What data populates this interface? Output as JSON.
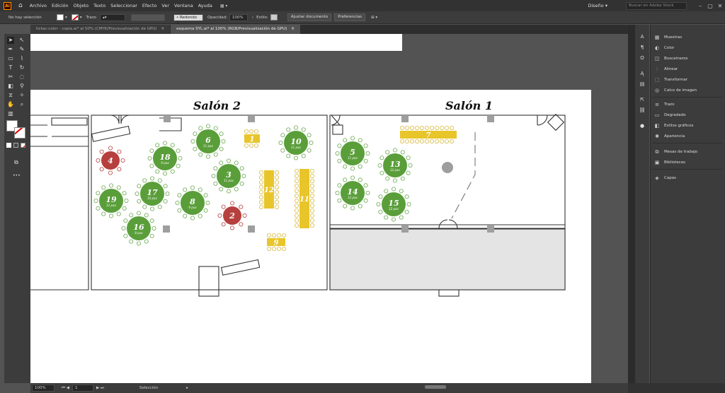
{
  "app": {
    "logo": "Ai"
  },
  "menu": [
    "Archivo",
    "Edición",
    "Objeto",
    "Texto",
    "Seleccionar",
    "Efecto",
    "Ver",
    "Ventana",
    "Ayuda"
  ],
  "workspace": "Diseño",
  "search_placeholder": "Buscar en Adobe Stock",
  "control": {
    "selection": "No hay selección",
    "stroke_label": "Trazo",
    "brush": "Redondo 3",
    "opacity_label": "Opacidad:",
    "opacity_value": "100%",
    "style_label": "Estilo:",
    "doc_button": "Ajustar documento",
    "prefs_button": "Preferencias"
  },
  "tabs": [
    {
      "label": "tictac-color - copia.ai* al 50% (CMYK/Previsualización de GPU)",
      "active": false
    },
    {
      "label": "esquema SYL.ai* al 100% (RGB/Previsualización de GPU)",
      "active": true
    }
  ],
  "panels": [
    "Muestras",
    "Color",
    "Buscatrazos",
    "Alinear",
    "Transformar",
    "Calco de imagen",
    "Trazo",
    "Degradado",
    "Estilos gráficos",
    "Apariencia",
    "Mesas de trabajo",
    "Bibliotecas",
    "Capas"
  ],
  "status": {
    "zoom": "100%",
    "page": "1",
    "tool": "Selección"
  },
  "plan": {
    "salon2_title": "Salón 2",
    "salon1_title": "Salón 1",
    "pax_suffix": "pax",
    "round_tables": [
      {
        "num": "18",
        "pax": "9",
        "color": "green"
      },
      {
        "num": "6",
        "pax": "11",
        "color": "green"
      },
      {
        "num": "10",
        "pax": "11",
        "color": "green"
      },
      {
        "num": "4",
        "pax": "",
        "color": "red"
      },
      {
        "num": "3",
        "pax": "11",
        "color": "green"
      },
      {
        "num": "17",
        "pax": "10",
        "color": "green"
      },
      {
        "num": "19",
        "pax": "12",
        "color": "green"
      },
      {
        "num": "8",
        "pax": "9",
        "color": "green"
      },
      {
        "num": "2",
        "pax": "",
        "color": "red"
      },
      {
        "num": "16",
        "pax": "8",
        "color": "green"
      },
      {
        "num": "5",
        "pax": "11",
        "color": "green"
      },
      {
        "num": "13",
        "pax": "12",
        "color": "green"
      },
      {
        "num": "14",
        "pax": "12",
        "color": "green"
      },
      {
        "num": "15",
        "pax": "12",
        "color": "green"
      }
    ],
    "rect_tables": [
      {
        "num": "1"
      },
      {
        "num": "12"
      },
      {
        "num": "11"
      },
      {
        "num": "9"
      },
      {
        "num": "7"
      }
    ]
  },
  "colors": {
    "green": "#5a9e3a",
    "red": "#b5403e",
    "yellow": "#e8c52a",
    "chair_green": "#6aa84f",
    "chair_yellow": "#d9b83a",
    "chair_red": "#b5403e",
    "gray": "#a9a9a9"
  }
}
